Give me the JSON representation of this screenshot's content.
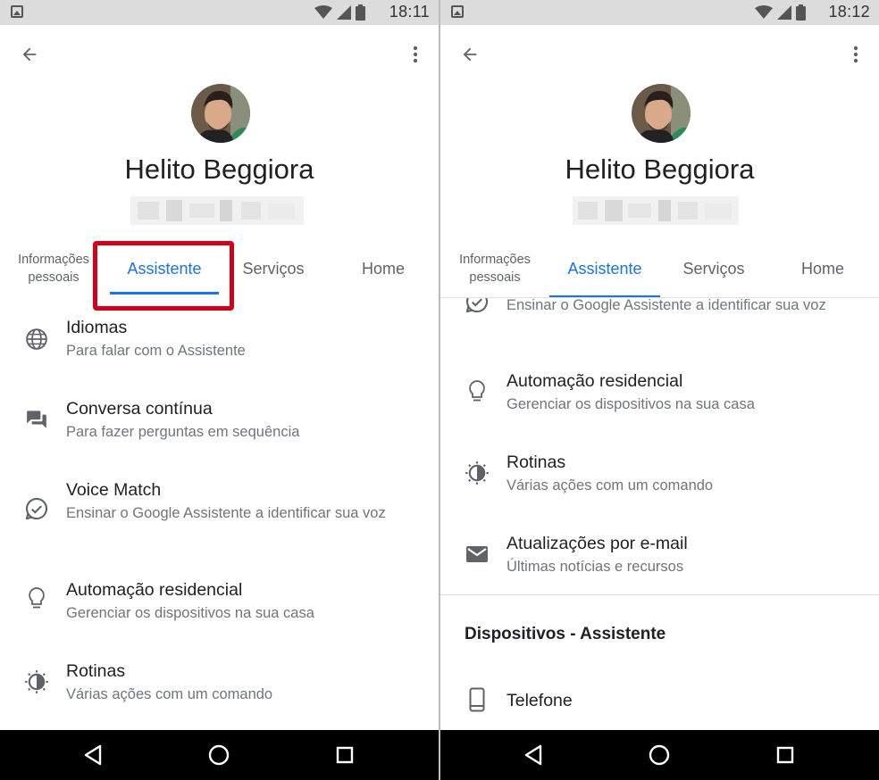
{
  "colors": {
    "accent": "#1a73e8",
    "highlight": "#d0021b",
    "text_primary": "#202124",
    "text_secondary": "#70757a",
    "statusbar": "#dcdcdc",
    "navbar": "#000000"
  },
  "left": {
    "status_time": "18:11",
    "profile": {
      "name": "Helito Beggiora"
    },
    "tabs": [
      {
        "label": "Informações pessoais",
        "active": false
      },
      {
        "label": "Assistente",
        "active": true
      },
      {
        "label": "Serviços",
        "active": false
      },
      {
        "label": "Home",
        "active": false
      }
    ],
    "items": [
      {
        "icon": "globe-icon",
        "title": "Idiomas",
        "subtitle": "Para falar com o Assistente"
      },
      {
        "icon": "chat-icon",
        "title": "Conversa contínua",
        "subtitle": "Para fazer perguntas em sequência"
      },
      {
        "icon": "voice-match-icon",
        "title": "Voice Match",
        "subtitle": "Ensinar o Google Assistente a identificar sua voz"
      },
      {
        "icon": "lightbulb-icon",
        "title": "Automação residencial",
        "subtitle": "Gerenciar os dispositivos na sua casa"
      },
      {
        "icon": "routines-icon",
        "title": "Rotinas",
        "subtitle": "Várias ações com um comando"
      }
    ]
  },
  "right": {
    "status_time": "18:12",
    "profile": {
      "name": "Helito Beggiora"
    },
    "tabs": [
      {
        "label": "Informações pessoais",
        "active": false
      },
      {
        "label": "Assistente",
        "active": true
      },
      {
        "label": "Serviços",
        "active": false
      },
      {
        "label": "Home",
        "active": false
      }
    ],
    "partial_item_subtitle": "Ensinar o Google Assistente a identificar sua voz",
    "items": [
      {
        "icon": "lightbulb-icon",
        "title": "Automação residencial",
        "subtitle": "Gerenciar os dispositivos na sua casa"
      },
      {
        "icon": "routines-icon",
        "title": "Rotinas",
        "subtitle": "Várias ações com um comando"
      },
      {
        "icon": "mail-icon",
        "title": "Atualizações por e-mail",
        "subtitle": "Últimas notícias e recursos"
      }
    ],
    "section_title": "Dispositivos - Assistente",
    "devices": [
      {
        "icon": "phone-icon",
        "title": "Telefone"
      }
    ]
  }
}
